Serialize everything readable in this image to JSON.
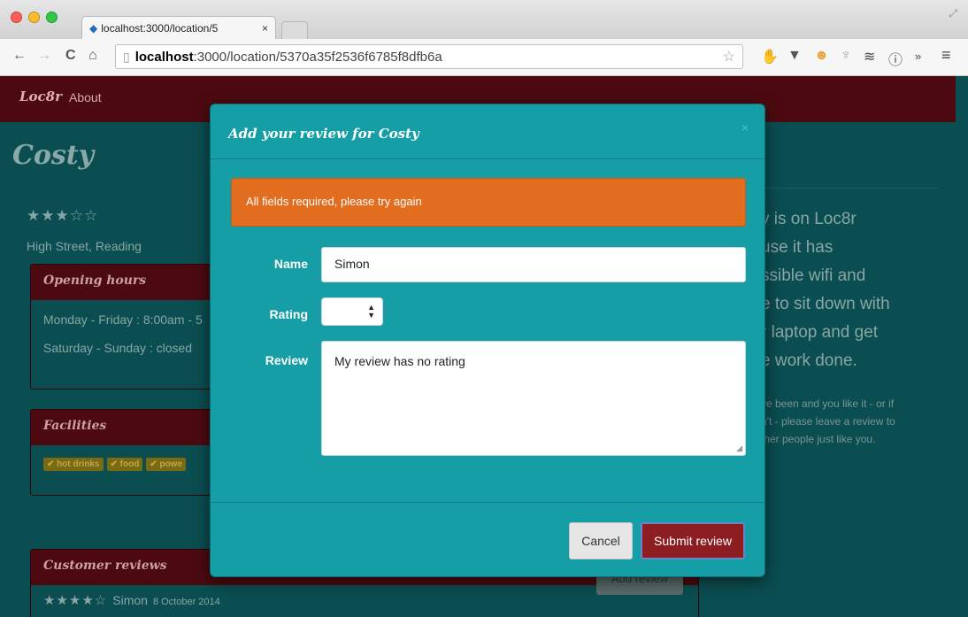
{
  "browser": {
    "tab_title": "localhost:3000/location/5",
    "tab_close": "×",
    "url_host": "localhost",
    "url_path": ":3000/location/5370a35f2536f6785f8dfb6a",
    "nav_back": "←",
    "nav_forward": "→",
    "nav_reload": "C",
    "nav_home": "⌂",
    "favicon": "◆",
    "bookmark_star": "☆",
    "extensions": [
      "hand-icon",
      "pocket-icon",
      "cat-icon",
      "pin-icon",
      "layers-icon",
      "info-icon"
    ],
    "overflow": "»",
    "menu": "≡"
  },
  "navbar": {
    "brand": "Loc8r",
    "about": "About"
  },
  "location": {
    "name": "Costy",
    "stars": "★★★☆☆",
    "address": "High Street, Reading",
    "hours_heading": "Opening hours",
    "hours": [
      "Monday - Friday : 8:00am - 5",
      "Saturday - Sunday : closed"
    ],
    "facilities_heading": "Facilities",
    "facilities": [
      "✔ hot drinks",
      "✔ food",
      "✔ powe"
    ],
    "reviews_heading": "Customer reviews",
    "add_review": "Add review",
    "review": {
      "stars": "★★★★☆",
      "author": "Simon",
      "date": "8 October 2014"
    },
    "sidebar_title": "y is on Loc8r\nuse it has\nssible wifi and\ne to sit down with\nr laptop and get\ne work done.",
    "sidebar_sub": "ve been and you like it - or if\nn't - please leave a review to\nther people just like you."
  },
  "modal": {
    "title": "Add your review for Costy",
    "close": "×",
    "alert": "All fields required, please try again",
    "name_label": "Name",
    "name_value": "Simon",
    "rating_label": "Rating",
    "rating_value": "",
    "review_label": "Review",
    "review_value": "My review has no rating",
    "cancel": "Cancel",
    "submit": "Submit review"
  },
  "colors": {
    "navbar": "#4c0a10",
    "modal_bg": "#159ea6",
    "alert": "#e36d1f",
    "submit_btn": "#8c1d21",
    "page_bg": "#0b4e51"
  }
}
